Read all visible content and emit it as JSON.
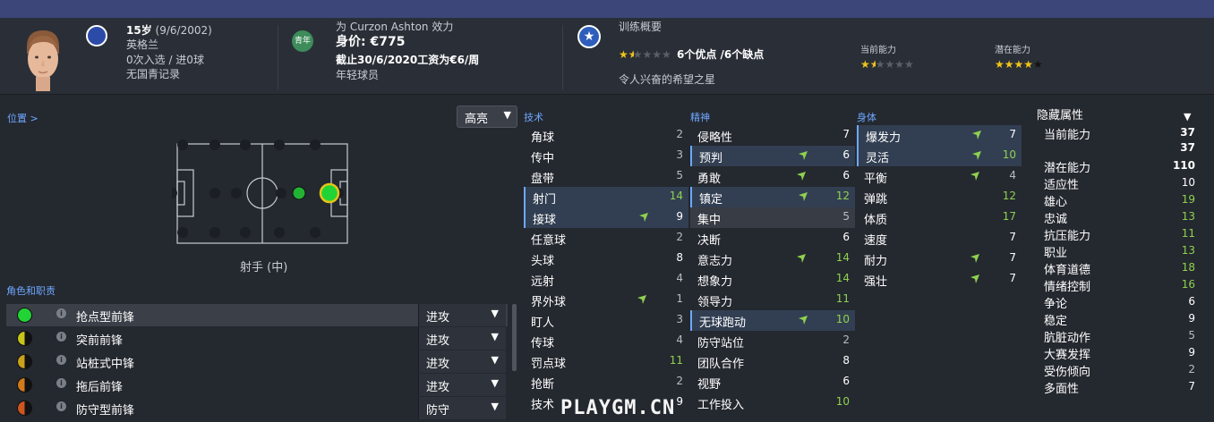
{
  "header": {
    "age": "15岁",
    "dob": "(9/6/2002)",
    "nation": "英格兰",
    "caps": "0次入选 / 进0球",
    "youth": "无国青记录",
    "club_line": "为 Curzon Ashton 效力",
    "youth_badge": "青年",
    "value": "身价: €775",
    "contract": "截止30/6/2020工资为€6/周",
    "status": "年轻球员",
    "training_title": "训练概要",
    "pros_cons": "6个优点 /6个缺点",
    "scout_comment": "令人兴奋的希望之星",
    "ca_label": "当前能力",
    "pa_label": "潜在能力",
    "overview_stars": 1.5,
    "ca_stars": 1.5,
    "pa_stars": 4,
    "star_glyph": "★"
  },
  "position": {
    "link": "位置 >",
    "highlight": "高亮",
    "label": "射手 (中)"
  },
  "roles": {
    "title": "角色和职责",
    "items": [
      {
        "name": "抢点型前锋",
        "duty": "进攻",
        "color": "#22d335"
      },
      {
        "name": "突前前锋",
        "duty": "进攻",
        "color": "#c8c41a"
      },
      {
        "name": "站桩式中锋",
        "duty": "进攻",
        "color": "#c9a11a"
      },
      {
        "name": "拖后前锋",
        "duty": "进攻",
        "color": "#d17a1c"
      },
      {
        "name": "防守型前锋",
        "duty": "防守",
        "color": "#d0561f"
      }
    ]
  },
  "technical": {
    "title": "技术",
    "items": [
      {
        "name": "角球",
        "value": "2"
      },
      {
        "name": "传中",
        "value": "3"
      },
      {
        "name": "盘带",
        "value": "5"
      },
      {
        "name": "射门",
        "value": "14"
      },
      {
        "name": "接球",
        "value": "9"
      },
      {
        "name": "任意球",
        "value": "2"
      },
      {
        "name": "头球",
        "value": "8"
      },
      {
        "name": "远射",
        "value": "4"
      },
      {
        "name": "界外球",
        "value": "1"
      },
      {
        "name": "盯人",
        "value": "3"
      },
      {
        "name": "传球",
        "value": "4"
      },
      {
        "name": "罚点球",
        "value": "11"
      },
      {
        "name": "抢断",
        "value": "2"
      },
      {
        "name": "技术",
        "value": "9"
      }
    ]
  },
  "mental": {
    "title": "精神",
    "items": [
      {
        "name": "侵略性",
        "value": "7"
      },
      {
        "name": "预判",
        "value": "6"
      },
      {
        "name": "勇敢",
        "value": "6"
      },
      {
        "name": "镇定",
        "value": "12"
      },
      {
        "name": "集中",
        "value": "5"
      },
      {
        "name": "决断",
        "value": "6"
      },
      {
        "name": "意志力",
        "value": "14"
      },
      {
        "name": "想象力",
        "value": "14"
      },
      {
        "name": "领导力",
        "value": "11"
      },
      {
        "name": "无球跑动",
        "value": "10"
      },
      {
        "name": "防守站位",
        "value": "2"
      },
      {
        "name": "团队合作",
        "value": "8"
      },
      {
        "name": "视野",
        "value": "6"
      },
      {
        "name": "工作投入",
        "value": "10"
      }
    ]
  },
  "physical": {
    "title": "身体",
    "items": [
      {
        "name": "爆发力",
        "value": "7"
      },
      {
        "name": "灵活",
        "value": "10"
      },
      {
        "name": "平衡",
        "value": "4"
      },
      {
        "name": "弹跳",
        "value": "12"
      },
      {
        "name": "体质",
        "value": "17"
      },
      {
        "name": "速度",
        "value": "7"
      },
      {
        "name": "耐力",
        "value": "7"
      },
      {
        "name": "强壮",
        "value": "7"
      }
    ]
  },
  "hidden": {
    "title": "隐藏属性",
    "items": [
      {
        "name": "当前能力",
        "value": "37"
      },
      {
        "name": "",
        "value": "37"
      },
      {
        "name": "潜在能力",
        "value": "110"
      },
      {
        "name": "适应性",
        "value": "10"
      },
      {
        "name": "雄心",
        "value": "19"
      },
      {
        "name": "忠诚",
        "value": "13"
      },
      {
        "name": "抗压能力",
        "value": "11"
      },
      {
        "name": "职业",
        "value": "13"
      },
      {
        "name": "体育道德",
        "value": "18"
      },
      {
        "name": "情绪控制",
        "value": "16"
      },
      {
        "name": "争论",
        "value": "6"
      },
      {
        "name": "稳定",
        "value": "9"
      },
      {
        "name": "肮脏动作",
        "value": "5"
      },
      {
        "name": "大赛发挥",
        "value": "9"
      },
      {
        "name": "受伤倾向",
        "value": "2"
      },
      {
        "name": "多面性",
        "value": "7"
      }
    ]
  },
  "watermark": "PLAYGM.CN"
}
